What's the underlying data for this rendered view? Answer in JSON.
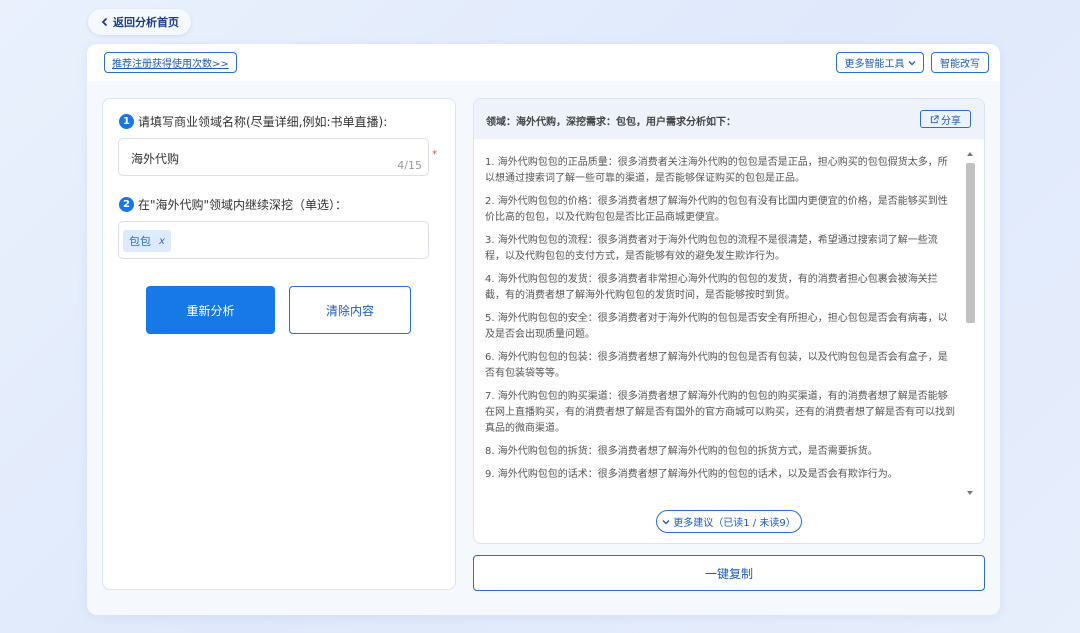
{
  "header": {
    "back_label": "返回分析首页",
    "promo_link": "推荐注册获得使用次数>>",
    "more_tools": "更多智能工具",
    "smart_rewrite": "智能改写"
  },
  "form": {
    "step1_number": "1",
    "step1_label": "请填写商业领域名称(尽量详细,例如:书单直播):",
    "domain_value": "海外代购",
    "char_count": "4/15",
    "required_mark": "*",
    "step2_number": "2",
    "step2_label": "在\"海外代购\"领域内继续深挖（单选）：",
    "selected_tag": "包包",
    "tag_remove": "x",
    "reanalyze_button": "重新分析",
    "clear_button": "清除内容"
  },
  "results": {
    "title": "领域：海外代购，深挖需求：包包，用户需求分析如下：",
    "share_label": "分享",
    "items": [
      "1. 海外代购包包的正品质量：很多消费者关注海外代购的包包是否是正品，担心购买的包包假货太多，所以想通过搜索词了解一些可靠的渠道，是否能够保证购买的包包是正品。",
      "2. 海外代购包包的价格：很多消费者想了解海外代购的包包有没有比国内更便宜的价格，是否能够买到性价比高的包包，以及代购包包是否比正品商城更便宜。",
      "3. 海外代购包包的流程：很多消费者对于海外代购包包的流程不是很清楚，希望通过搜索词了解一些流程，以及代购包包的支付方式，是否能够有效的避免发生欺诈行为。",
      "4. 海外代购包包的发货：很多消费者非常担心海外代购的包包的发货，有的消费者担心包裹会被海关拦截，有的消费者想了解海外代购包包的发货时间，是否能够按时到货。",
      "5. 海外代购包包的安全：很多消费者对于海外代购的包包是否安全有所担心，担心包包是否会有病毒，以及是否会出现质量问题。",
      "6. 海外代购包包的包装：很多消费者想了解海外代购的包包是否有包装，以及代购包包是否会有盒子，是否有包装袋等等。",
      "7. 海外代购包包的购买渠道：很多消费者想了解海外代购的包包的购买渠道，有的消费者想了解是否能够在网上直播购买，有的消费者想了解是否有国外的官方商城可以购买，还有的消费者想了解是否有可以找到真品的微商渠道。",
      "8. 海外代购包包的拆货：很多消费者想了解海外代购的包包的拆货方式，是否需要拆货。",
      "9. 海外代购包包的话术：很多消费者想了解海外代购的包包的话术，以及是否会有欺诈行为。"
    ],
    "more_label": "更多建议（已读1 / 未读9）",
    "copy_button": "一键复制"
  },
  "icons": {
    "back": "chevron-left-icon",
    "dropdown": "chevron-down-icon",
    "share": "share-icon",
    "more": "chevron-down-icon"
  },
  "colors": {
    "accent": "#1779e8",
    "link": "#1d5bc7",
    "required": "#e24c4c"
  }
}
